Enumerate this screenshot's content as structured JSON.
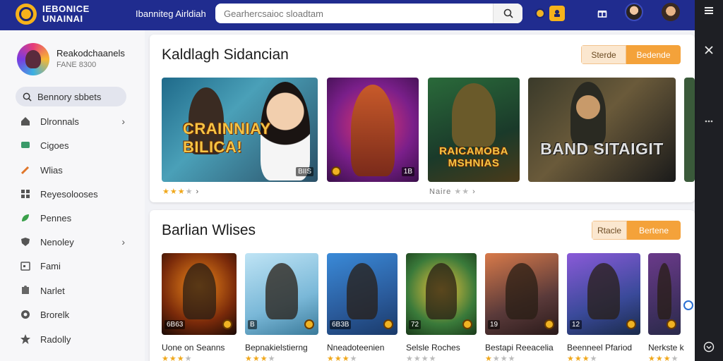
{
  "header": {
    "brand_line1": "IEBONICE",
    "brand_line2": "UNAINAI",
    "nav_text": "Ibanniteg Airldiah",
    "search_placeholder": "Gearhercsaioc sloadtam"
  },
  "sidebar": {
    "profile_name": "Reakodchaanels",
    "profile_sub": "FANE 8300",
    "search_label": "Bennory sbbets",
    "items": [
      {
        "label": "Dlronnals",
        "icon": "home-icon",
        "chevron": true
      },
      {
        "label": "Cigoes",
        "icon": "chat-icon",
        "chevron": false
      },
      {
        "label": "Wlias",
        "icon": "wand-icon",
        "chevron": false
      },
      {
        "label": "Reyesolooses",
        "icon": "grid-icon",
        "chevron": false
      },
      {
        "label": "Pennes",
        "icon": "leaf-icon",
        "chevron": false
      },
      {
        "label": "Nenoley",
        "icon": "shield-icon",
        "chevron": true
      },
      {
        "label": "Fami",
        "icon": "calendar-icon",
        "chevron": false
      },
      {
        "label": "Narlet",
        "icon": "puzzle-icon",
        "chevron": false
      },
      {
        "label": "Brorelk",
        "icon": "gamepad-icon",
        "chevron": false
      },
      {
        "label": "Radolly",
        "icon": "star-icon",
        "chevron": false
      }
    ]
  },
  "section1": {
    "title": "Kaldlagh Sidancian",
    "btn_a": "Sterde",
    "btn_b": "Bedende",
    "tiles": [
      {
        "label": "CRAINNIAY BILICA!",
        "badge": "BIIS"
      },
      {
        "label": "",
        "badge": "1B"
      },
      {
        "label": "RAICAMOBA MSHNIAS",
        "badge": ""
      },
      {
        "label": "BAND SITAIGIT",
        "badge": ""
      }
    ],
    "rating1_stars": 3,
    "rating2_text": "Naire"
  },
  "section2": {
    "title": "Barlian Wlises",
    "btn_a": "Rtacle",
    "btn_b": "Bertene",
    "games": [
      {
        "title": "Uone on Seanns",
        "badge": "6B63",
        "stars": 3
      },
      {
        "title": "Bepnakielstierng",
        "badge": "B",
        "stars": 3
      },
      {
        "title": "Nneadoteenien",
        "badge": "6B3B",
        "stars": 3
      },
      {
        "title": "Selsle Roches",
        "badge": "72",
        "stars": 0
      },
      {
        "title": "Bestapi Reeacelia",
        "badge": "19",
        "stars": 1
      },
      {
        "title": "Beenneel Pfariod",
        "badge": "12",
        "stars": 3
      },
      {
        "title": "Nerkste k",
        "badge": "",
        "stars": 3
      }
    ]
  },
  "colors": {
    "topbar": "#202c8f",
    "accent": "#f4a23a",
    "rail": "#1e1f24"
  }
}
